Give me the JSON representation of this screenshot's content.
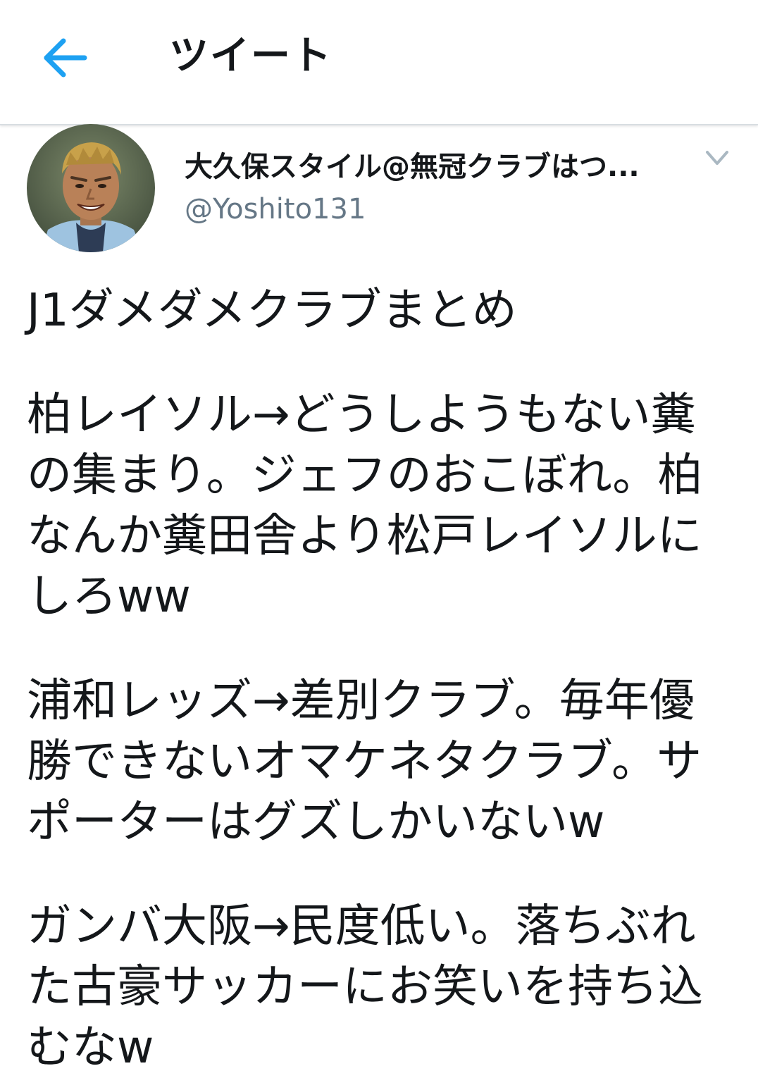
{
  "header": {
    "back_icon": "arrow-left-icon",
    "title": "ツイート"
  },
  "tweet": {
    "author": {
      "display_name": "大久保スタイル@無冠クラブはつ...",
      "handle": "@Yoshito131",
      "avatar_icon": "avatar-photo"
    },
    "more_icon": "chevron-down-icon",
    "paragraphs": [
      {
        "lines": [
          "J1ダメダメクラブまとめ"
        ]
      },
      {
        "lines": [
          "柏レイソル→どうしようもない糞",
          "の集まり。ジェフのおこぼれ。柏",
          "なんか糞田舎より松戸レイソルに",
          "しろww"
        ]
      },
      {
        "lines": [
          "浦和レッズ→差別クラブ。毎年優",
          "勝できないオマケネタクラブ。サ",
          "ポーターはグズしかいないw"
        ]
      },
      {
        "lines": [
          "ガンバ大阪→民度低い。落ちぶれ",
          "た古豪サッカーにお笑いを持ち込",
          "むなw"
        ]
      }
    ]
  },
  "colors": {
    "accent": "#1da1f2",
    "text_primary": "#14171a",
    "text_secondary": "#657786",
    "divider": "#d8dde1"
  }
}
